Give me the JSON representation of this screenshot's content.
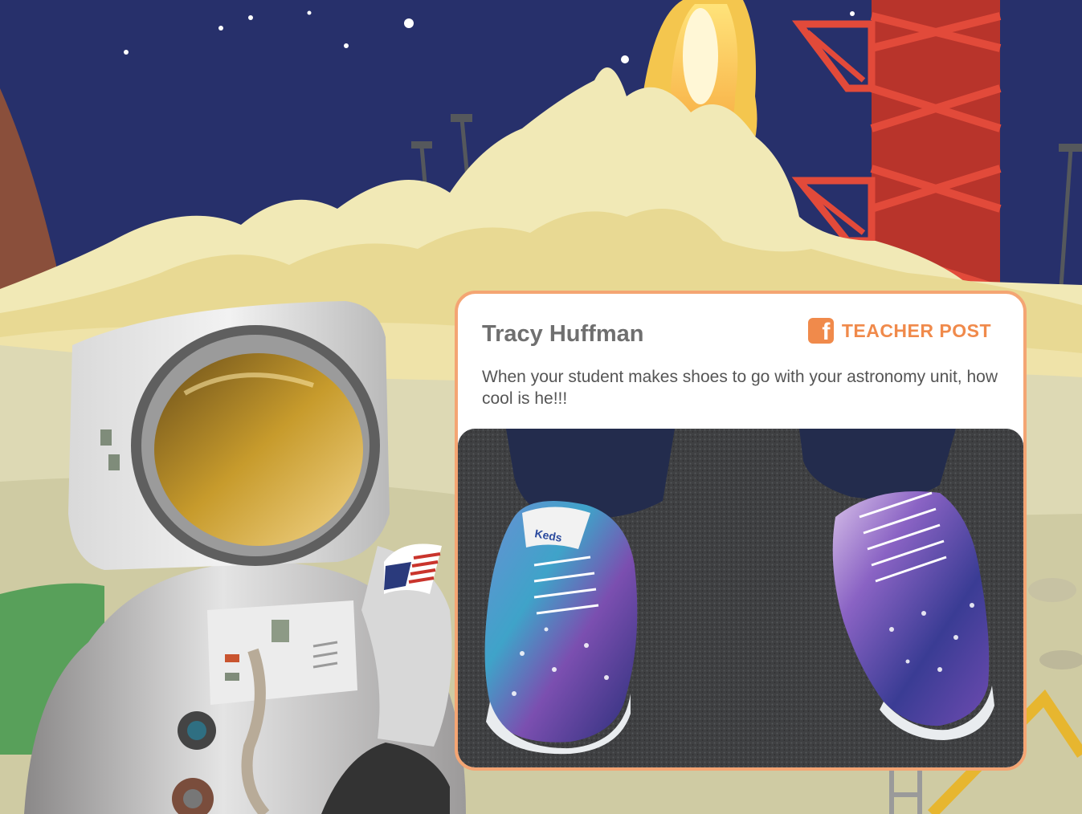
{
  "post": {
    "author": "Tracy Huffman",
    "badge_label": "TEACHER POST",
    "badge_icon": "facebook-icon",
    "text": "When your student makes shoes to go with your astronomy unit, how cool is he!!!",
    "photo_brand_text": "Keds"
  },
  "colors": {
    "sky": "#27306b",
    "card_border": "#f4a573",
    "accent": "#f08a4b",
    "tower": "#d63b2f"
  }
}
